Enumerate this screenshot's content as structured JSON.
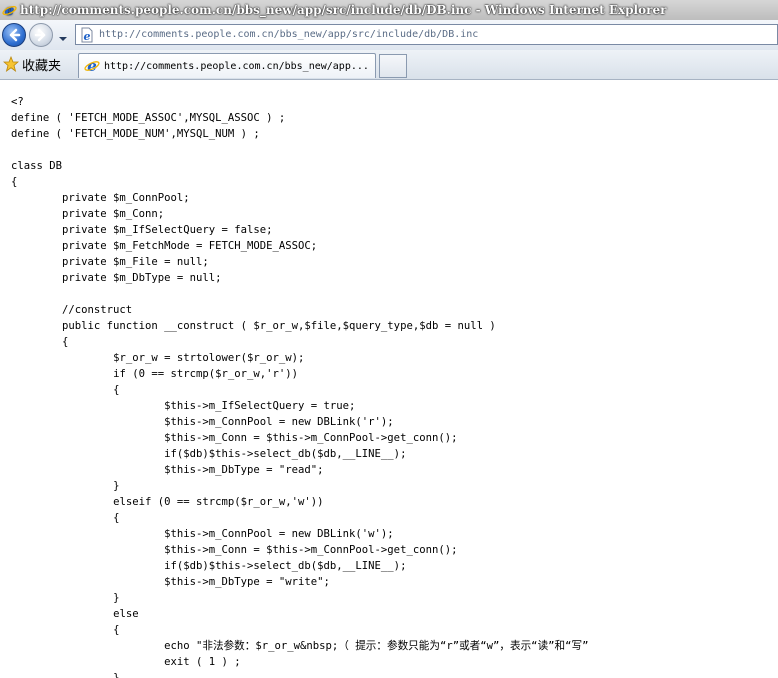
{
  "window": {
    "title": "http://comments.people.com.cn/bbs_new/app/src/include/db/DB.inc - Windows Internet Explorer"
  },
  "address_bar": {
    "url": "http://comments.people.com.cn/bbs_new/app/src/include/db/DB.inc"
  },
  "favorites": {
    "label": "收藏夹"
  },
  "tab": {
    "label": "http://comments.people.com.cn/bbs_new/app..."
  },
  "icons": {
    "title_icon": "ie-logo-icon",
    "back": "back-arrow-icon",
    "forward": "forward-arrow-icon",
    "recent_pages": "chevron-down-icon",
    "address_icon": "page-icon",
    "favorites": "star-icon",
    "tab_icon": "ie-logo-icon"
  },
  "colors": {
    "ie_blue": "#1e62c9",
    "link_text": "#5a6c86"
  },
  "content": {
    "code": "<?\ndefine ( 'FETCH_MODE_ASSOC',MYSQL_ASSOC ) ;\ndefine ( 'FETCH_MODE_NUM',MYSQL_NUM ) ;\n\nclass DB\n{\n\tprivate $m_ConnPool;\n\tprivate $m_Conn;\n\tprivate $m_IfSelectQuery = false;\n\tprivate $m_FetchMode = FETCH_MODE_ASSOC;\n\tprivate $m_File = null;\n\tprivate $m_DbType = null;\n\n\t//construct\n\tpublic function __construct ( $r_or_w,$file,$query_type,$db = null )\n\t{\n\t\t$r_or_w = strtolower($r_or_w);\n\t\tif (0 == strcmp($r_or_w,'r'))\n\t\t{\n\t\t\t$this->m_IfSelectQuery = true;\n\t\t\t$this->m_ConnPool = new DBLink('r');\n\t\t\t$this->m_Conn = $this->m_ConnPool->get_conn();\n\t\t\tif($db)$this->select_db($db,__LINE__);\n\t\t\t$this->m_DbType = \"read\";\n\t\t}\n\t\telseif (0 == strcmp($r_or_w,'w'))\n\t\t{\n\t\t\t$this->m_ConnPool = new DBLink('w');\n\t\t\t$this->m_Conn = $this->m_ConnPool->get_conn();\n\t\t\tif($db)$this->select_db($db,__LINE__);\n\t\t\t$this->m_DbType = \"write\";\n\t\t}\n\t\telse\n\t\t{\n\t\t\techo \"非法参数：$r_or_w&nbsp;（ 提示：参数只能为“r”或者“w”，表示“读”和“写”\n\t\t\texit ( 1 ) ;\n\t\t}"
  }
}
